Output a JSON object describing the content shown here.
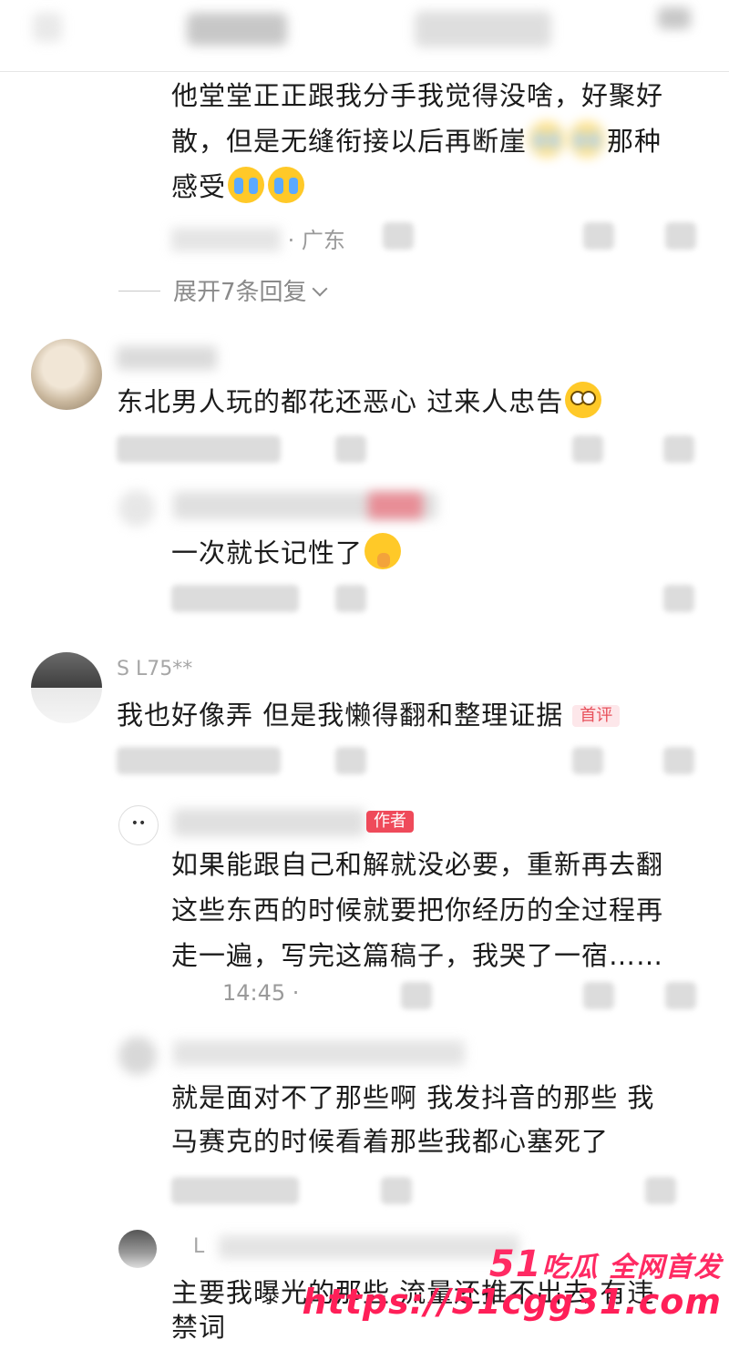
{
  "comments": {
    "c1": {
      "text_line1": "他堂堂正正跟我分手我觉得没啥，好聚好",
      "text_line2": "散，但是无缝衔接以后再断崖",
      "text_line2_tail": "那种",
      "text_line3": "感受",
      "location": "· 广东"
    },
    "expand_replies": "展开7条回复",
    "c2": {
      "text": "东北男人玩的都花还恶心 过来人忠告",
      "reply_text": "一次就长记性了"
    },
    "c3": {
      "username": "S L75**",
      "text": "我也好像弄 但是我懒得翻和整理证据",
      "first_badge": "首评",
      "author_reply": {
        "badge": "作者",
        "line1": "如果能跟自己和解就没必要，重新再去翻",
        "line2": "这些东西的时候就要把你经历的全过程再",
        "line3": "走一遍，写完这篇稿子，我哭了一宿……",
        "time": "14:45 ·"
      },
      "reply2_line1": "就是面对不了那些啊 我发抖音的那些 我",
      "reply2_line2": "马赛克的时候看着那些我都心塞死了",
      "reply3_user": "L",
      "reply3_line1": "主要我曝光的那些 流量还推不出去 有违",
      "reply3_line2": "禁词"
    }
  },
  "watermark": {
    "num": "51",
    "text": "吃瓜 全网首发",
    "url": "https://51cgg31.com"
  },
  "colors": {
    "accent": "#ef4a5a",
    "meta": "#9a9a9a",
    "watermark": "#ff2a63"
  },
  "icons": [
    "back-icon",
    "more-icon",
    "emoji-cry",
    "emoji-smirk",
    "emoji-pray",
    "chevron-down-icon"
  ]
}
